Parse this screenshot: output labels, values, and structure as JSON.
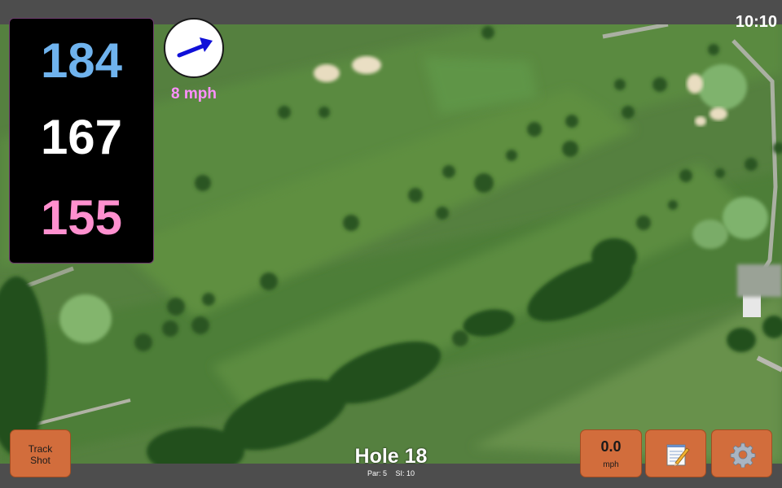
{
  "status": {
    "time": "10:10"
  },
  "distances": {
    "back": "184",
    "middle": "167",
    "front": "155"
  },
  "wind": {
    "speed": "8 mph",
    "icon": "wind-arrow-icon"
  },
  "buttons": {
    "track_shot": "Track Shot",
    "speed_value": "0.0",
    "speed_unit": "mph",
    "notes_icon": "notepad-icon",
    "settings_icon": "gear-icon"
  },
  "hole": {
    "title": "Hole 18",
    "par": "Par: 5",
    "si": "SI: 10"
  },
  "colors": {
    "back_distance": "#6fb3ee",
    "middle_distance": "#ffffff",
    "front_distance": "#ff90cf",
    "wind_text": "#ff90ff",
    "button": "#d26d3c",
    "wind_arrow": "#1010d8"
  }
}
